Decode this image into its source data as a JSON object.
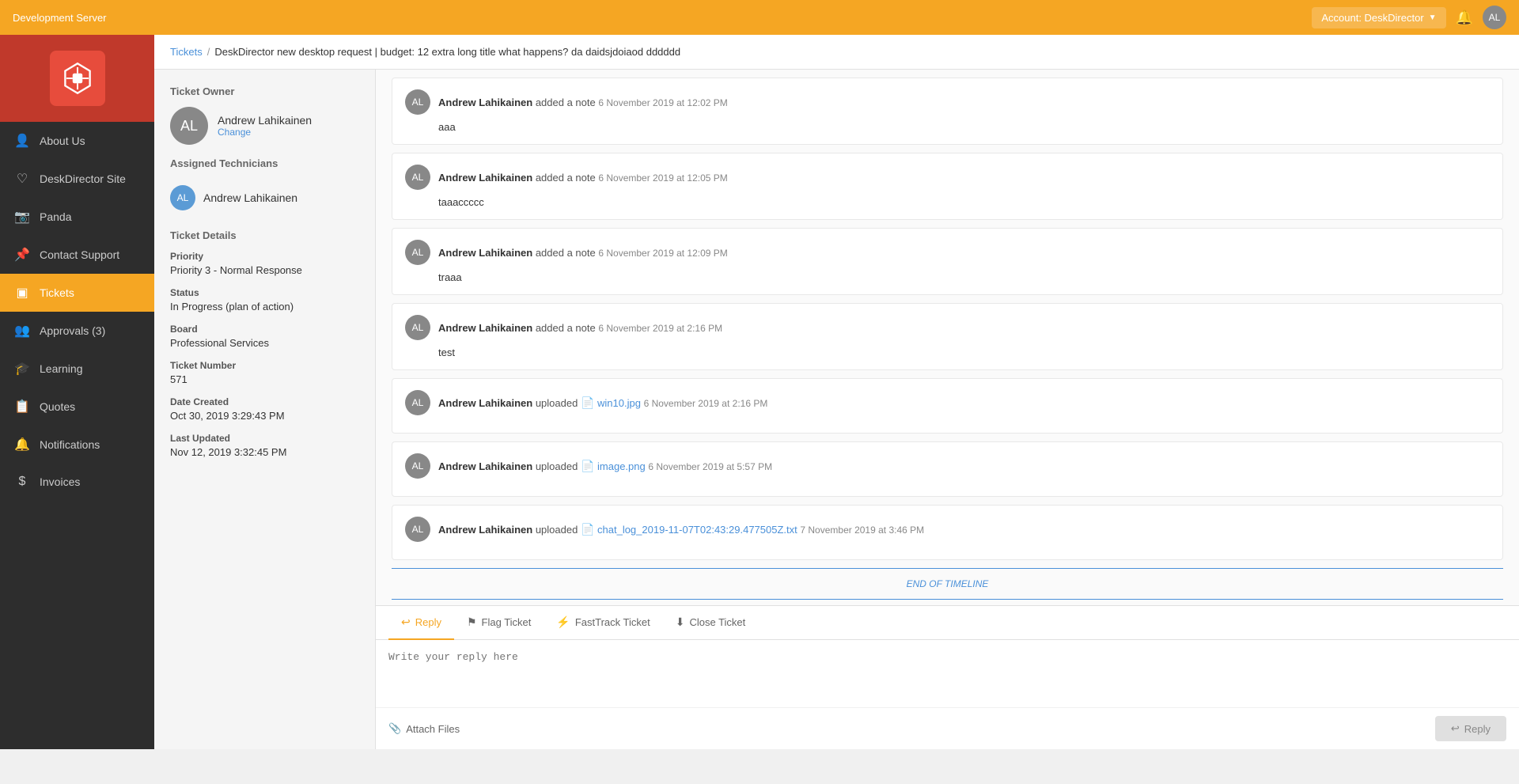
{
  "app": {
    "server_name": "Development Server",
    "account_label": "Account: DeskDirector",
    "chevron": "▼"
  },
  "sidebar": {
    "items": [
      {
        "id": "about-us",
        "label": "About Us",
        "icon": "👤",
        "active": false
      },
      {
        "id": "deskdirector-site",
        "label": "DeskDirector Site",
        "icon": "♡",
        "active": false
      },
      {
        "id": "panda",
        "label": "Panda",
        "icon": "📷",
        "active": false
      },
      {
        "id": "contact-support",
        "label": "Contact Support",
        "icon": "📍",
        "active": false
      },
      {
        "id": "tickets",
        "label": "Tickets",
        "icon": "□",
        "active": true
      },
      {
        "id": "approvals",
        "label": "Approvals (3)",
        "icon": "👥",
        "active": false,
        "badge": "3"
      },
      {
        "id": "learning",
        "label": "Learning",
        "icon": "🎓",
        "active": false
      },
      {
        "id": "quotes",
        "label": "Quotes",
        "icon": "📋",
        "active": false
      },
      {
        "id": "notifications",
        "label": "Notifications",
        "icon": "🔔",
        "active": false
      },
      {
        "id": "invoices",
        "label": "Invoices",
        "icon": "$",
        "active": false
      }
    ]
  },
  "breadcrumb": {
    "link_label": "Tickets",
    "separator": "/",
    "current": "DeskDirector new desktop request | budget: 12 extra long title what happens? da daidsjdoiaod dddddd"
  },
  "ticket_panel": {
    "owner_section": "Ticket Owner",
    "owner_name": "Andrew Lahikainen",
    "owner_change": "Change",
    "assigned_section": "Assigned Technicians",
    "assigned_name": "Andrew Lahikainen",
    "details_section": "Ticket Details",
    "priority_label": "Priority",
    "priority_value": "Priority 3 - Normal Response",
    "status_label": "Status",
    "status_value": "In Progress (plan of action)",
    "board_label": "Board",
    "board_value": "Professional Services",
    "ticket_number_label": "Ticket Number",
    "ticket_number_value": "571",
    "date_created_label": "Date Created",
    "date_created_value": "Oct 30, 2019 3:29:43 PM",
    "last_updated_label": "Last Updated",
    "last_updated_value": "Nov 12, 2019 3:32:45 PM"
  },
  "timeline": {
    "entries": [
      {
        "id": 1,
        "author": "Andrew Lahikainen",
        "action": "added a note",
        "time": "6 November 2019 at 12:02 PM",
        "body": "aaa",
        "type": "note"
      },
      {
        "id": 2,
        "author": "Andrew Lahikainen",
        "action": "added a note",
        "time": "6 November 2019 at 12:05 PM",
        "body": "taaaccccc",
        "type": "note"
      },
      {
        "id": 3,
        "author": "Andrew Lahikainen",
        "action": "added a note",
        "time": "6 November 2019 at 12:09 PM",
        "body": "traaa",
        "type": "note"
      },
      {
        "id": 4,
        "author": "Andrew Lahikainen",
        "action": "added a note",
        "time": "6 November 2019 at 2:16 PM",
        "body": "test",
        "type": "note"
      },
      {
        "id": 5,
        "author": "Andrew Lahikainen",
        "action": "uploaded",
        "time": "6 November 2019 at 2:16 PM",
        "body": "",
        "type": "upload",
        "filename": "win10.jpg"
      },
      {
        "id": 6,
        "author": "Andrew Lahikainen",
        "action": "uploaded",
        "time": "6 November 2019 at 5:57 PM",
        "body": "",
        "type": "upload",
        "filename": "image.png"
      },
      {
        "id": 7,
        "author": "Andrew Lahikainen",
        "action": "uploaded",
        "time": "7 November 2019 at 3:46 PM",
        "body": "",
        "type": "upload",
        "filename": "chat_log_2019-11-07T02:43:29.477505Z.txt"
      }
    ],
    "end_label": "END OF TIMELINE"
  },
  "reply": {
    "tabs": [
      {
        "id": "reply",
        "label": "Reply",
        "icon": "↩",
        "active": true
      },
      {
        "id": "flag-ticket",
        "label": "Flag Ticket",
        "icon": "⚑",
        "active": false
      },
      {
        "id": "fasttrack",
        "label": "FastTrack Ticket",
        "icon": "⚡",
        "active": false
      },
      {
        "id": "close-ticket",
        "label": "Close Ticket",
        "icon": "⬇",
        "active": false
      }
    ],
    "placeholder": "Write your reply here",
    "attach_label": "Attach Files",
    "send_label": "Reply",
    "send_icon": "↩"
  }
}
